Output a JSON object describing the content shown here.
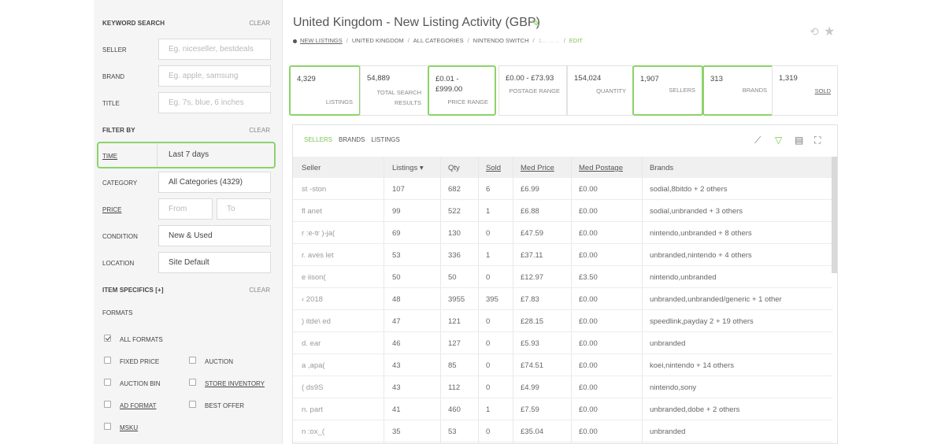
{
  "sidebar": {
    "keyword_search": "KEYWORD SEARCH",
    "clear": "CLEAR",
    "seller": {
      "label": "SELLER",
      "placeholder": "Eg. niceseller, bestdeals"
    },
    "brand": {
      "label": "BRAND",
      "placeholder": "Eg. apple, samsung"
    },
    "title": {
      "label": "TITLE",
      "placeholder": "Eg. 7s, blue, 6 inches"
    },
    "filter_by": "FILTER BY",
    "time": {
      "label": "TIME",
      "value": "Last 7 days"
    },
    "category": {
      "label": "CATEGORY",
      "value": "All Categories (4329)"
    },
    "price": {
      "label": "PRICE",
      "from": "From",
      "to": "To"
    },
    "condition": {
      "label": "CONDITION",
      "value": "New & Used"
    },
    "location": {
      "label": "LOCATION",
      "value": "Site Default"
    },
    "item_specifics": "ITEM SPECIFICS [+]",
    "formats": "FORMATS",
    "format_options": {
      "all": "ALL FORMATS",
      "fixed": "FIXED PRICE",
      "auction": "AUCTION",
      "auction_bin": "AUCTION BIN",
      "store_inventory": "STORE INVENTORY",
      "ad_format": "AD FORMAT",
      "best_offer": "BEST OFFER",
      "msku": "MSKU"
    }
  },
  "header": {
    "title": "United Kingdom - New Listing Activity (GBP)",
    "breadcrumb": {
      "new_listings": "NEW LISTINGS",
      "country": "UNITED KINGDOM",
      "category": "ALL CATEGORIES",
      "keyword": "NINTENDO SWITCH",
      "dates": "1... ... ...",
      "edit": "EDIT"
    }
  },
  "stats": [
    {
      "value": "4,329",
      "label": "LISTINGS"
    },
    {
      "value": "54,889",
      "label": "TOTAL SEARCH RESULTS"
    },
    {
      "value": "£0.01 - £999.00",
      "label": "PRICE RANGE"
    },
    {
      "value": "£0.00 - £73.93",
      "label": "POSTAGE RANGE"
    },
    {
      "value": "154,024",
      "label": "QUANTITY"
    },
    {
      "value": "1,907",
      "label": "SELLERS"
    },
    {
      "value": "313",
      "label": "BRANDS"
    },
    {
      "value": "1,319",
      "label": "SOLD"
    }
  ],
  "table": {
    "tabs": [
      "SELLERS",
      "BRANDS",
      "LISTINGS"
    ],
    "columns": [
      "Seller",
      "Listings ▾",
      "Qty",
      "Sold",
      "Med Price",
      "Med Postage",
      "Brands"
    ],
    "rows": [
      [
        "st    -ston",
        "107",
        "682",
        "6",
        "£6.99",
        "£0.00",
        "sodial,8bitdo + 2 others"
      ],
      [
        "fl    anet",
        "99",
        "522",
        "1",
        "£6.88",
        "£0.00",
        "sodial,unbranded + 3 others"
      ],
      [
        "r   :e-tr   )-ja(",
        "69",
        "130",
        "0",
        "£47.59",
        "£0.00",
        "nintendo,unbranded + 8 others"
      ],
      [
        "r.    aves     let",
        "53",
        "336",
        "1",
        "£37.11",
        "£0.00",
        "unbranded,nintendo + 4 others"
      ],
      [
        "e     iison(",
        "50",
        "50",
        "0",
        "£12.97",
        "£3.50",
        "nintendo,unbranded"
      ],
      [
        "‹    2018",
        "48",
        "3955",
        "395",
        "£7.83",
        "£0.00",
        "unbranded,unbranded/generic + 1 other"
      ],
      [
        ")    itde\\     ed",
        "47",
        "121",
        "0",
        "£28.15",
        "£0.00",
        "speedlink,payday 2 + 19 others"
      ],
      [
        "d.    ear",
        "46",
        "127",
        "0",
        "£5.93",
        "£0.00",
        "unbranded"
      ],
      [
        "a    ,apa(",
        "43",
        "85",
        "0",
        "£74.51",
        "£0.00",
        "koei,nintendo + 14 others"
      ],
      [
        "(    ds9S",
        "43",
        "112",
        "0",
        "£4.99",
        "£0.00",
        "nintendo,sony"
      ],
      [
        "n.    part",
        "41",
        "460",
        "1",
        "£7.59",
        "£0.00",
        "unbranded,dobe + 2 others"
      ],
      [
        "n    :ox_(",
        "35",
        "53",
        "0",
        "£35.04",
        "£0.00",
        "unbranded"
      ]
    ]
  },
  "colors": {
    "accent": "#7bc34f",
    "highlight": "#8cd36a"
  }
}
